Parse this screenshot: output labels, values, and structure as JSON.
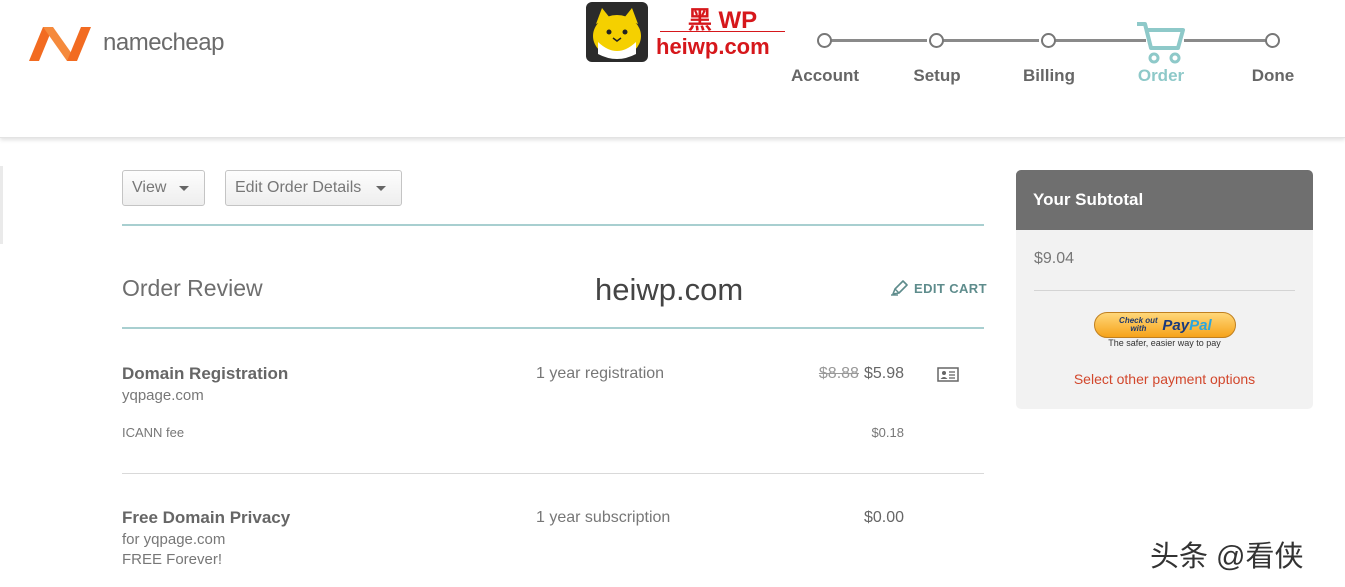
{
  "brand": {
    "name": "namecheap",
    "accent": "#f26b21"
  },
  "watermark": {
    "top_text": "黑 WP",
    "bottom_text": "heiwp.com",
    "center_text": "heiwp.com",
    "corner_text": "头条 @看侠"
  },
  "steps": [
    {
      "label": "Account",
      "active": false
    },
    {
      "label": "Setup",
      "active": false
    },
    {
      "label": "Billing",
      "active": false
    },
    {
      "label": "Order",
      "active": true
    },
    {
      "label": "Done",
      "active": false
    }
  ],
  "toolbar": {
    "view_label": "View",
    "edit_order_label": "Edit Order Details"
  },
  "order": {
    "title": "Order Review",
    "edit_cart_label": "EDIT CART",
    "items": [
      {
        "title": "Domain Registration",
        "subtitle": "yqpage.com",
        "description": "1 year registration",
        "old_price": "$8.88",
        "price": "$5.98",
        "fee_label": "ICANN fee",
        "fee_price": "$0.18"
      },
      {
        "title": "Free Domain Privacy",
        "subtitle": "for yqpage.com",
        "subtitle2": "FREE Forever!",
        "description": "1 year subscription",
        "price": "$0.00"
      }
    ]
  },
  "subtotal": {
    "heading": "Your Subtotal",
    "amount": "$9.04",
    "paypal_checkout": "Check out with",
    "paypal_tagline": "The safer, easier way to pay",
    "other_payment_label": "Select other payment options"
  },
  "colors": {
    "step_active": "#8ec9c9",
    "link_red": "#d2472c",
    "teal_rule": "#a8cfd0"
  }
}
